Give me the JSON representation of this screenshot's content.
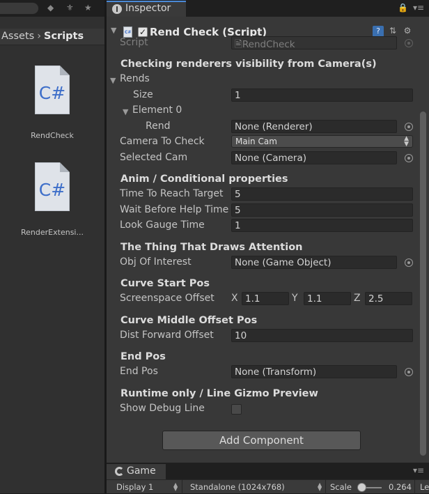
{
  "project": {
    "breadcrumb": [
      "Assets",
      "Scripts"
    ],
    "files": [
      {
        "name": "RendCheck",
        "icon": "C#"
      },
      {
        "name": "RenderExtensi...",
        "icon": "C#"
      }
    ]
  },
  "inspector": {
    "tab_label": "Inspector",
    "component_title": "Rend Check (Script)",
    "component_enabled": true,
    "script_label": "Script",
    "script_value": "RendCheck",
    "sections": {
      "checking": "Checking renderers visibility from Camera(s)",
      "anim": "Anim / Conditional properties",
      "thing": "The Thing That Draws Attention",
      "curve_start": "Curve Start Pos",
      "curve_middle": "Curve Middle Offset Pos",
      "end_pos": "End Pos",
      "runtime": "Runtime only / Line Gizmo Preview"
    },
    "rends_label": "Rends",
    "size_label": "Size",
    "size_value": "1",
    "element0_label": "Element 0",
    "rend_label": "Rend",
    "rend_value": "None (Renderer)",
    "camera_to_check_label": "Camera To Check",
    "camera_to_check_value": "Main Cam",
    "selected_cam_label": "Selected Cam",
    "selected_cam_value": "None (Camera)",
    "time_to_reach_label": "Time To Reach Target",
    "time_to_reach_value": "5",
    "wait_before_help_label": "Wait Before Help Time",
    "wait_before_help_value": "5",
    "look_gauge_label": "Look Gauge Time",
    "look_gauge_value": "1",
    "obj_of_interest_label": "Obj Of Interest",
    "obj_of_interest_value": "None (Game Object)",
    "screenspace_offset_label": "Screenspace Offset",
    "screenspace_offset": {
      "x_label": "X",
      "x": "1.1",
      "y_label": "Y",
      "y": "1.1",
      "z_label": "Z",
      "z": "2.5"
    },
    "dist_forward_label": "Dist Forward Offset",
    "dist_forward_value": "10",
    "end_pos_label": "End Pos",
    "end_pos_value": "None (Transform)",
    "show_debug_label": "Show Debug Line",
    "show_debug_checked": false,
    "add_component_label": "Add Component"
  },
  "game": {
    "tab_label": "Game",
    "display_label": "Display 1",
    "resolution_label": "Standalone (1024x768)",
    "scale_label": "Scale",
    "scale_value": "0.264",
    "truncated_label": "Le"
  },
  "colors": {
    "background": "#383838",
    "tab_accent": "#4a8ad8",
    "field_bg": "#2b2b2b",
    "csharp_blue": "#3d6ec9"
  }
}
